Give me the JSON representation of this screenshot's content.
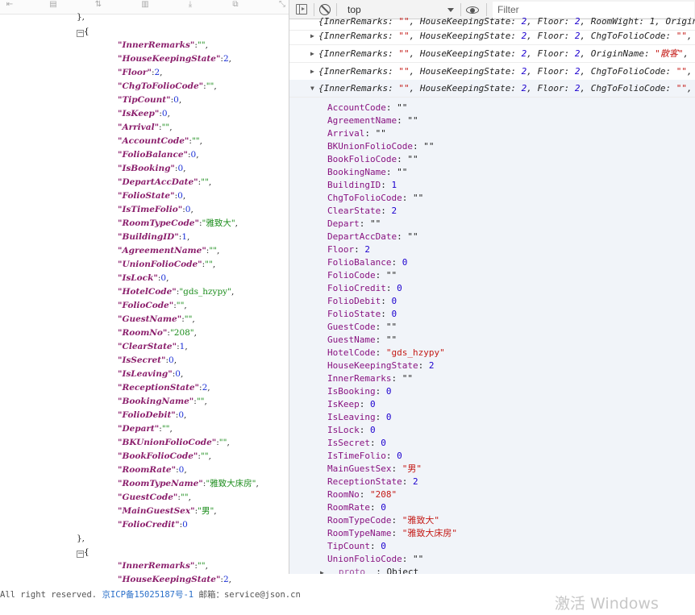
{
  "left_toolbar": {
    "icons": [
      "collapse-icon",
      "excel-icon",
      "sort-icon",
      "delete-icon",
      "download-icon",
      "copy-icon",
      "expand-icon"
    ]
  },
  "json_viewer": {
    "top_fragment": "},",
    "objects": [
      {
        "fields": [
          {
            "key": "\"InnerRemarks\"",
            "value": "\"\"",
            "type": "string"
          },
          {
            "key": "\"HouseKeepingState\"",
            "value": "2",
            "type": "number"
          },
          {
            "key": "\"Floor\"",
            "value": "2",
            "type": "number"
          },
          {
            "key": "\"ChgToFolioCode\"",
            "value": "\"\"",
            "type": "string"
          },
          {
            "key": "\"TipCount\"",
            "value": "0",
            "type": "number"
          },
          {
            "key": "\"IsKeep\"",
            "value": "0",
            "type": "number"
          },
          {
            "key": "\"Arrival\"",
            "value": "\"\"",
            "type": "string"
          },
          {
            "key": "\"AccountCode\"",
            "value": "\"\"",
            "type": "string"
          },
          {
            "key": "\"FolioBalance\"",
            "value": "0",
            "type": "number"
          },
          {
            "key": "\"IsBooking\"",
            "value": "0",
            "type": "number"
          },
          {
            "key": "\"DepartAccDate\"",
            "value": "\"\"",
            "type": "string"
          },
          {
            "key": "\"FolioState\"",
            "value": "0",
            "type": "number"
          },
          {
            "key": "\"IsTimeFolio\"",
            "value": "0",
            "type": "number"
          },
          {
            "key": "\"RoomTypeCode\"",
            "value": "\"雅致大\"",
            "type": "string"
          },
          {
            "key": "\"BuildingID\"",
            "value": "1",
            "type": "number"
          },
          {
            "key": "\"AgreementName\"",
            "value": "\"\"",
            "type": "string"
          },
          {
            "key": "\"UnionFolioCode\"",
            "value": "\"\"",
            "type": "string"
          },
          {
            "key": "\"IsLock\"",
            "value": "0",
            "type": "number"
          },
          {
            "key": "\"HotelCode\"",
            "value": "\"gds_hzypy\"",
            "type": "string"
          },
          {
            "key": "\"FolioCode\"",
            "value": "\"\"",
            "type": "string"
          },
          {
            "key": "\"GuestName\"",
            "value": "\"\"",
            "type": "string"
          },
          {
            "key": "\"RoomNo\"",
            "value": "\"208\"",
            "type": "string"
          },
          {
            "key": "\"ClearState\"",
            "value": "1",
            "type": "number"
          },
          {
            "key": "\"IsSecret\"",
            "value": "0",
            "type": "number"
          },
          {
            "key": "\"IsLeaving\"",
            "value": "0",
            "type": "number"
          },
          {
            "key": "\"ReceptionState\"",
            "value": "2",
            "type": "number"
          },
          {
            "key": "\"BookingName\"",
            "value": "\"\"",
            "type": "string"
          },
          {
            "key": "\"FolioDebit\"",
            "value": "0",
            "type": "number"
          },
          {
            "key": "\"Depart\"",
            "value": "\"\"",
            "type": "string"
          },
          {
            "key": "\"BKUnionFolioCode\"",
            "value": "\"\"",
            "type": "string"
          },
          {
            "key": "\"BookFolioCode\"",
            "value": "\"\"",
            "type": "string"
          },
          {
            "key": "\"RoomRate\"",
            "value": "0",
            "type": "number"
          },
          {
            "key": "\"RoomTypeName\"",
            "value": "\"雅致大床房\"",
            "type": "string"
          },
          {
            "key": "\"GuestCode\"",
            "value": "\"\"",
            "type": "string"
          },
          {
            "key": "\"MainGuestSex\"",
            "value": "\"男\"",
            "type": "string"
          },
          {
            "key": "\"FolioCredit\"",
            "value": "0",
            "type": "number",
            "last": true
          }
        ]
      },
      {
        "fields": [
          {
            "key": "\"InnerRemarks\"",
            "value": "\"\"",
            "type": "string"
          },
          {
            "key": "\"HouseKeepingState\"",
            "value": "2",
            "type": "number"
          }
        ]
      }
    ]
  },
  "console": {
    "toolbar": {
      "context": "top",
      "filter_placeholder": "Filter"
    },
    "collapsed_rows": [
      {
        "partial": true,
        "parts": [
          {
            "t": "{InnerRemarks: ",
            "c": "ci cv-p"
          },
          {
            "t": "\"\"",
            "c": "ci cv-s"
          },
          {
            "t": ", HouseKeepingState: ",
            "c": "ci cv-p"
          },
          {
            "t": "2",
            "c": "ci cv-n"
          },
          {
            "t": ", Floor: ",
            "c": "ci cv-p"
          },
          {
            "t": "2",
            "c": "ci cv-n"
          },
          {
            "t": ", RoomWight: 1, Origin",
            "c": "ci cv-p"
          }
        ]
      },
      {
        "parts": [
          {
            "t": "{InnerRemarks: ",
            "c": "ci cv-p"
          },
          {
            "t": "\"\"",
            "c": "ci cv-s"
          },
          {
            "t": ", HouseKeepingState: ",
            "c": "ci cv-p"
          },
          {
            "t": "2",
            "c": "ci cv-n"
          },
          {
            "t": ", Floor: ",
            "c": "ci cv-p"
          },
          {
            "t": "2",
            "c": "ci cv-n"
          },
          {
            "t": ", ChgToFolioCode: ",
            "c": "ci cv-p"
          },
          {
            "t": "\"\"",
            "c": "ci cv-s"
          },
          {
            "t": ",",
            "c": "ci cv-p"
          }
        ]
      },
      {
        "parts": [
          {
            "t": "{InnerRemarks: ",
            "c": "ci cv-p"
          },
          {
            "t": "\"\"",
            "c": "ci cv-s"
          },
          {
            "t": ", HouseKeepingState: ",
            "c": "ci cv-p"
          },
          {
            "t": "2",
            "c": "ci cv-n"
          },
          {
            "t": ", Floor: ",
            "c": "ci cv-p"
          },
          {
            "t": "2",
            "c": "ci cv-n"
          },
          {
            "t": ", OriginName: ",
            "c": "ci cv-p"
          },
          {
            "t": "\"散客\"",
            "c": "ci cv-s"
          },
          {
            "t": ", ",
            "c": "ci cv-p"
          }
        ]
      },
      {
        "parts": [
          {
            "t": "{InnerRemarks: ",
            "c": "ci cv-p"
          },
          {
            "t": "\"\"",
            "c": "ci cv-s"
          },
          {
            "t": ", HouseKeepingState: ",
            "c": "ci cv-p"
          },
          {
            "t": "2",
            "c": "ci cv-n"
          },
          {
            "t": ", Floor: ",
            "c": "ci cv-p"
          },
          {
            "t": "2",
            "c": "ci cv-n"
          },
          {
            "t": ", ChgToFolioCode: ",
            "c": "ci cv-p"
          },
          {
            "t": "\"\"",
            "c": "ci cv-s"
          },
          {
            "t": ",",
            "c": "ci cv-p"
          }
        ]
      }
    ],
    "expanded_header": [
      {
        "t": "{InnerRemarks: ",
        "c": "ci cv-p"
      },
      {
        "t": "\"\"",
        "c": "ci cv-s"
      },
      {
        "t": ", HouseKeepingState: ",
        "c": "ci cv-p"
      },
      {
        "t": "2",
        "c": "ci cv-n"
      },
      {
        "t": ", Floor: ",
        "c": "ci cv-p"
      },
      {
        "t": "2",
        "c": "ci cv-n"
      },
      {
        "t": ", ChgToFolioCode: ",
        "c": "ci cv-p"
      },
      {
        "t": "\"\"",
        "c": "ci cv-s"
      },
      {
        "t": ",",
        "c": "ci cv-p"
      }
    ],
    "expanded_props": [
      {
        "key": "AccountCode",
        "value": "\"\"",
        "type": "string-empty"
      },
      {
        "key": "AgreementName",
        "value": "\"\"",
        "type": "string-empty"
      },
      {
        "key": "Arrival",
        "value": "\"\"",
        "type": "string-empty"
      },
      {
        "key": "BKUnionFolioCode",
        "value": "\"\"",
        "type": "string-empty"
      },
      {
        "key": "BookFolioCode",
        "value": "\"\"",
        "type": "string-empty"
      },
      {
        "key": "BookingName",
        "value": "\"\"",
        "type": "string-empty"
      },
      {
        "key": "BuildingID",
        "value": "1",
        "type": "number"
      },
      {
        "key": "ChgToFolioCode",
        "value": "\"\"",
        "type": "string-empty"
      },
      {
        "key": "ClearState",
        "value": "2",
        "type": "number"
      },
      {
        "key": "Depart",
        "value": "\"\"",
        "type": "string-empty"
      },
      {
        "key": "DepartAccDate",
        "value": "\"\"",
        "type": "string-empty"
      },
      {
        "key": "Floor",
        "value": "2",
        "type": "number"
      },
      {
        "key": "FolioBalance",
        "value": "0",
        "type": "number"
      },
      {
        "key": "FolioCode",
        "value": "\"\"",
        "type": "string-empty"
      },
      {
        "key": "FolioCredit",
        "value": "0",
        "type": "number"
      },
      {
        "key": "FolioDebit",
        "value": "0",
        "type": "number"
      },
      {
        "key": "FolioState",
        "value": "0",
        "type": "number"
      },
      {
        "key": "GuestCode",
        "value": "\"\"",
        "type": "string-empty"
      },
      {
        "key": "GuestName",
        "value": "\"\"",
        "type": "string-empty"
      },
      {
        "key": "HotelCode",
        "value": "\"gds_hzypy\"",
        "type": "string"
      },
      {
        "key": "HouseKeepingState",
        "value": "2",
        "type": "number"
      },
      {
        "key": "InnerRemarks",
        "value": "\"\"",
        "type": "string-empty"
      },
      {
        "key": "IsBooking",
        "value": "0",
        "type": "number"
      },
      {
        "key": "IsKeep",
        "value": "0",
        "type": "number"
      },
      {
        "key": "IsLeaving",
        "value": "0",
        "type": "number"
      },
      {
        "key": "IsLock",
        "value": "0",
        "type": "number"
      },
      {
        "key": "IsSecret",
        "value": "0",
        "type": "number"
      },
      {
        "key": "IsTimeFolio",
        "value": "0",
        "type": "number"
      },
      {
        "key": "MainGuestSex",
        "value": "\"男\"",
        "type": "string"
      },
      {
        "key": "ReceptionState",
        "value": "2",
        "type": "number"
      },
      {
        "key": "RoomNo",
        "value": "\"208\"",
        "type": "string"
      },
      {
        "key": "RoomRate",
        "value": "0",
        "type": "number"
      },
      {
        "key": "RoomTypeCode",
        "value": "\"雅致大\"",
        "type": "string"
      },
      {
        "key": "RoomTypeName",
        "value": "\"雅致大床房\"",
        "type": "string"
      },
      {
        "key": "TipCount",
        "value": "0",
        "type": "number"
      },
      {
        "key": "UnionFolioCode",
        "value": "\"\"",
        "type": "string-empty"
      }
    ],
    "proto": {
      "key": "__proto__",
      "value": "Object"
    }
  },
  "footer": {
    "prefix": "All right reserved. ",
    "icp": "京ICP备15025187号-1",
    "mail_label": " 邮箱：",
    "mail": "service@json.cn"
  },
  "watermark": "激活 Windows",
  "colors": {
    "json_key": "#8b1f6c",
    "json_string": "#1a8c1a",
    "json_number": "#1a2fd6",
    "console_key": "#881280",
    "console_string": "#c41a16",
    "console_number": "#1c00cf",
    "expanded_bg": "#f1f4f9"
  }
}
